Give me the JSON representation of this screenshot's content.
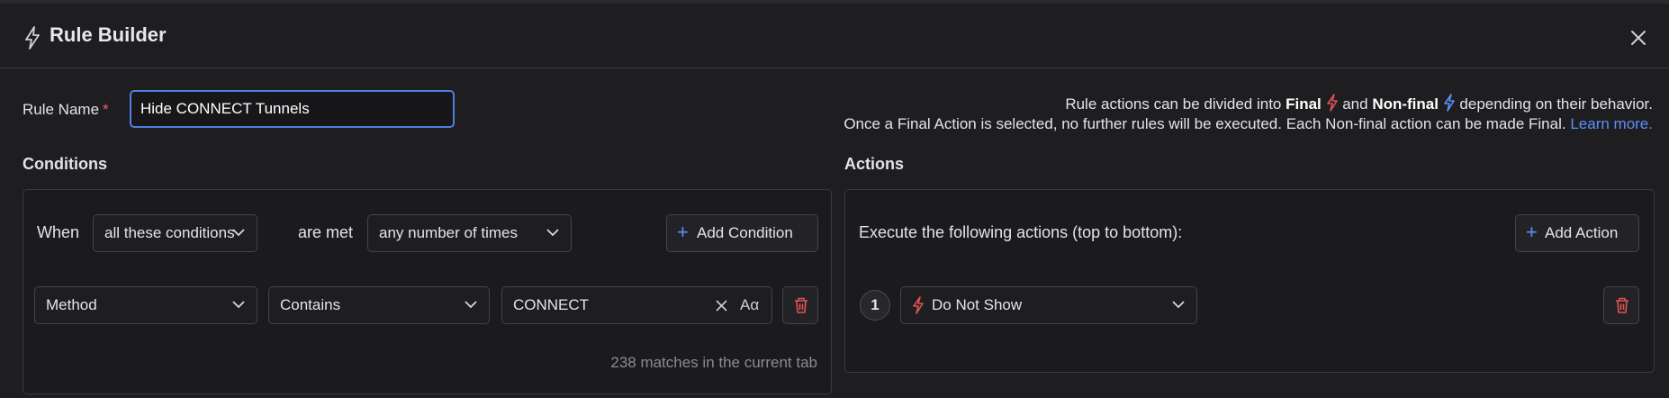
{
  "dialog": {
    "title": "Rule Builder",
    "close_icon": "close-icon"
  },
  "rule": {
    "name_label": "Rule Name",
    "required_mark": "*",
    "name_value": "Hide CONNECT Tunnels"
  },
  "info": {
    "line1_prefix": "Rule actions can be divided into ",
    "final": "Final",
    "and": " and ",
    "non_final": "Non-final",
    "line1_suffix": " depending on their behavior.",
    "line2": "Once a Final Action is selected, no further rules will be executed. Each Non-final action can be made Final. ",
    "learn_more": "Learn more.",
    "final_color": "#e05252",
    "non_final_color": "#5b8ff9"
  },
  "conditions": {
    "heading": "Conditions",
    "when": "When",
    "match_mode": "all these conditions",
    "are_met": "are met",
    "frequency": "any number of times",
    "add_button": "Add Condition",
    "row": {
      "field": "Method",
      "operator": "Contains",
      "value": "CONNECT",
      "case_toggle": "Aα"
    },
    "matches": "238 matches in the current tab"
  },
  "actions": {
    "heading": "Actions",
    "description": "Execute the following actions (top to bottom):",
    "add_button": "Add Action",
    "items": [
      {
        "index": "1",
        "label": "Do Not Show",
        "icon": "bolt-icon"
      }
    ]
  },
  "colors": {
    "accent": "#5b8ff9",
    "danger": "#e05252",
    "background": "#1e1e21"
  }
}
